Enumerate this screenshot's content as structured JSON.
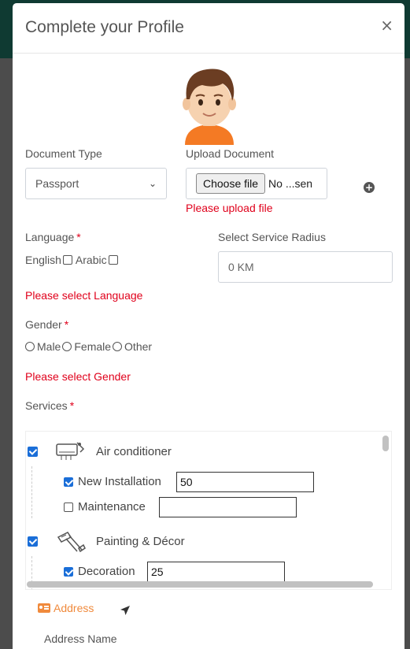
{
  "modal": {
    "title": "Complete your Profile",
    "close_symbol": "×"
  },
  "document": {
    "type_label": "Document Type",
    "type_selected": "Passport",
    "upload_label": "Upload Document",
    "choose_file_label": "Choose file",
    "file_name": "No ...sen",
    "upload_error": "Please upload file"
  },
  "language": {
    "label": "Language",
    "required_mark": "*",
    "options": [
      "English",
      "Arabic"
    ],
    "error": "Please select Language"
  },
  "service_radius": {
    "label": "Select Service Radius",
    "placeholder": "0 KM"
  },
  "gender": {
    "label": "Gender",
    "required_mark": "*",
    "options": [
      "Male",
      "Female",
      "Other"
    ],
    "error": "Please select Gender"
  },
  "services": {
    "label": "Services",
    "required_mark": "*",
    "items": [
      {
        "name": "Air conditioner",
        "checked": true,
        "icon": "air-conditioner-icon",
        "subs": [
          {
            "name": "New Installation",
            "checked": true,
            "value": "50"
          },
          {
            "name": "Maintenance",
            "checked": false,
            "value": ""
          }
        ]
      },
      {
        "name": "Painting & Décor",
        "checked": true,
        "icon": "paint-roller-icon",
        "subs": [
          {
            "name": "Decoration",
            "checked": true,
            "value": "25"
          }
        ]
      }
    ]
  },
  "address": {
    "tab_label": "Address",
    "name_label": "Address Name"
  },
  "colors": {
    "accent": "#f08a3c",
    "error": "#e0001b",
    "checkbox": "#1a6ed8"
  }
}
